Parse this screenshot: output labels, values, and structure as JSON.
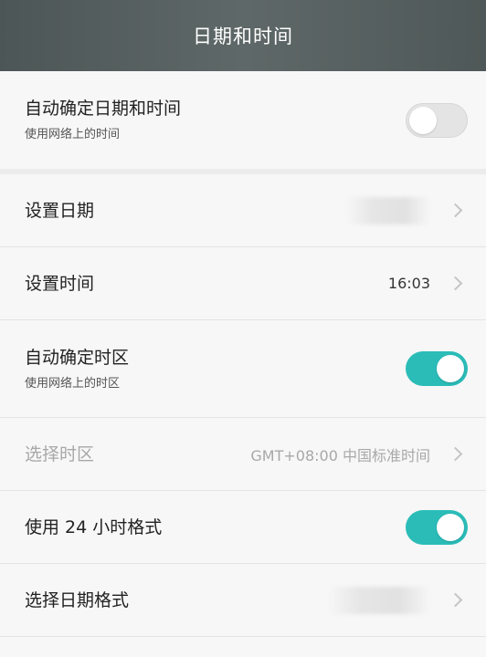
{
  "header": {
    "title": "日期和时间"
  },
  "settings": {
    "auto_datetime": {
      "title": "自动确定日期和时间",
      "subtitle": "使用网络上的时间",
      "enabled": false
    },
    "set_date": {
      "title": "设置日期"
    },
    "set_time": {
      "title": "设置时间",
      "value": "16:03"
    },
    "auto_timezone": {
      "title": "自动确定时区",
      "subtitle": "使用网络上的时区",
      "enabled": true
    },
    "select_timezone": {
      "title": "选择时区",
      "value": "GMT+08:00 中国标准时间",
      "disabled": true
    },
    "use_24h": {
      "title": "使用 24 小时格式",
      "enabled": true
    },
    "date_format": {
      "title": "选择日期格式"
    }
  },
  "colors": {
    "accent": "#2bbcb8",
    "header_bg": "#5a6363",
    "disabled_text": "#a8a8a8"
  },
  "icons": [
    "chevron-right-icon"
  ]
}
